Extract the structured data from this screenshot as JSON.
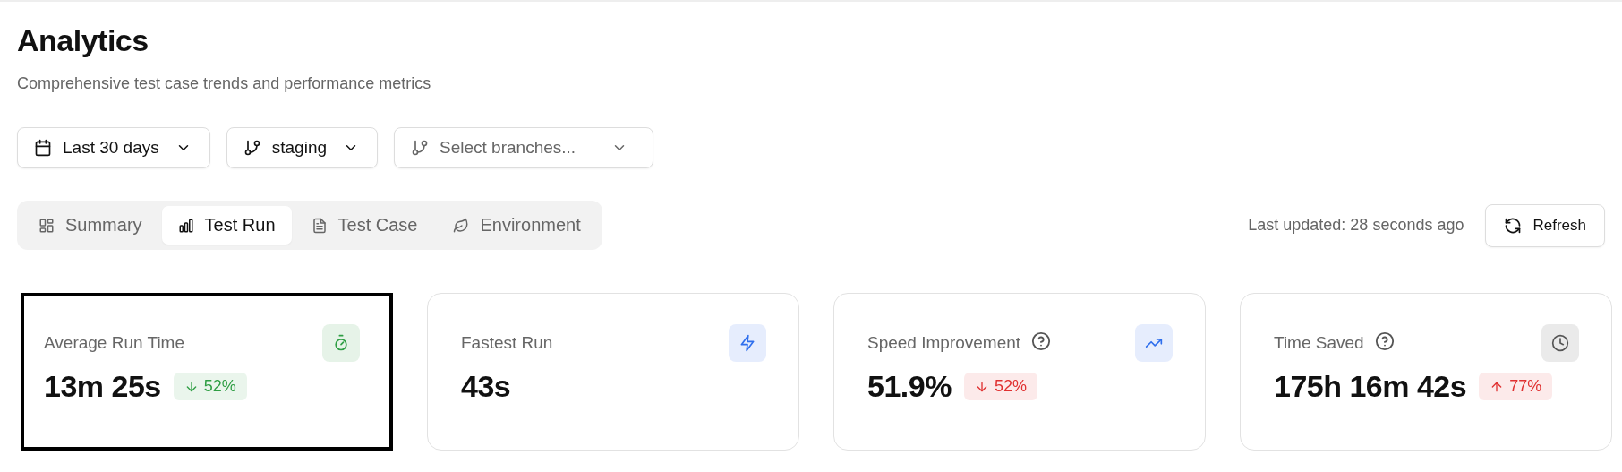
{
  "header": {
    "title": "Analytics",
    "subtitle": "Comprehensive test case trends and performance metrics"
  },
  "filters": [
    {
      "kind": "calendar",
      "label": "Last 30 days",
      "placeholder": false
    },
    {
      "kind": "branch",
      "label": "staging",
      "placeholder": false
    },
    {
      "kind": "branch",
      "label": "Select branches...",
      "placeholder": true
    }
  ],
  "tabs": [
    {
      "kind": "summary",
      "label": "Summary",
      "selected": false
    },
    {
      "kind": "bars",
      "label": "Test Run",
      "selected": true
    },
    {
      "kind": "document",
      "label": "Test Case",
      "selected": false
    },
    {
      "kind": "leaf",
      "label": "Environment",
      "selected": false
    }
  ],
  "last_updated": "Last updated: 28 seconds ago",
  "refresh_button": "Refresh",
  "cards": [
    {
      "title": "Average Run Time",
      "help": false,
      "kind": "stopwatch",
      "color": "#2f9e44",
      "value": "13m 25s",
      "selected": true,
      "change": {
        "kind": "down",
        "text": "52%",
        "color": "#2f9e44"
      }
    },
    {
      "title": "Fastest Run",
      "help": false,
      "kind": "zap",
      "color": "#2f6fed",
      "value": "43s",
      "selected": false
    },
    {
      "title": "Speed Improvement",
      "help": true,
      "kind": "trend",
      "color": "#2f6fed",
      "value": "51.9%",
      "selected": false,
      "change": {
        "kind": "down",
        "text": "52%",
        "color": "#e03131"
      }
    },
    {
      "title": "Time Saved",
      "help": true,
      "kind": "clock",
      "color": "#555555",
      "value": "175h 16m 42s",
      "selected": false,
      "change": {
        "kind": "up",
        "text": "77%",
        "color": "#e03131"
      }
    }
  ]
}
